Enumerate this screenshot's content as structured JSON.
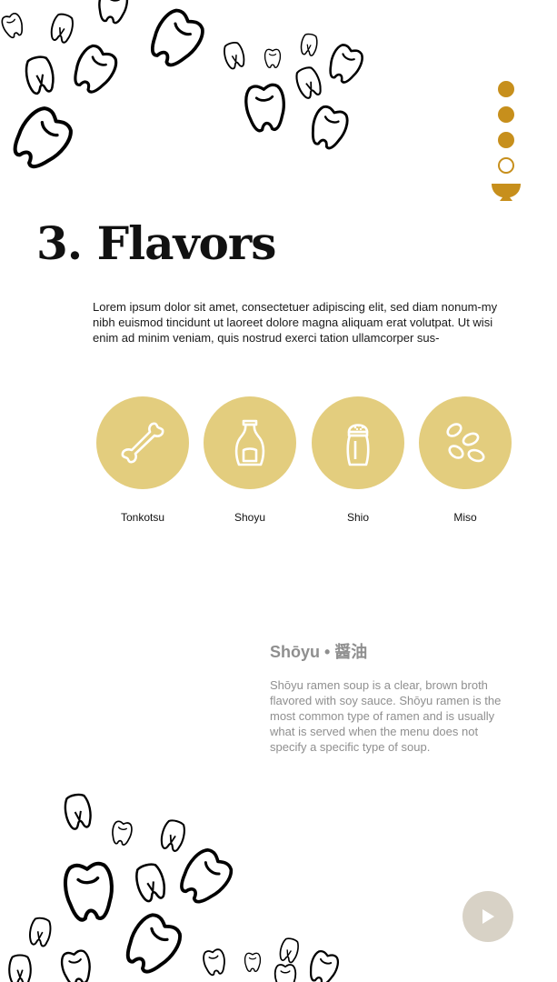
{
  "section": {
    "title": "3. Flavors",
    "lead": "Lorem ipsum dolor sit amet, consectetuer adipiscing elit, sed diam nonum-my nibh euismod tincidunt ut laoreet dolore magna aliquam erat volutpat. Ut wisi enim ad minim veniam, quis nostrud exerci tation ullamcorper sus-"
  },
  "progress": {
    "steps": [
      {
        "state": "complete"
      },
      {
        "state": "complete"
      },
      {
        "state": "complete"
      },
      {
        "state": "incomplete"
      }
    ],
    "icon": "ramen-bowl-icon",
    "accent_color": "#C78F1C"
  },
  "flavors": [
    {
      "label": "Tonkotsu",
      "icon": "bone-icon"
    },
    {
      "label": "Shoyu",
      "icon": "soy-sauce-bottle-icon"
    },
    {
      "label": "Shio",
      "icon": "salt-shaker-icon"
    },
    {
      "label": "Miso",
      "icon": "soybeans-icon"
    }
  ],
  "detail": {
    "title": "Shōyu • 醤油",
    "body": "Shōyu ramen soup is a clear, brown broth flavored with soy sauce. Shōyu ramen is the most common type of ramen and is usually what is served when the menu does not specify a specific type of soup."
  },
  "play_button": {
    "icon": "play-icon",
    "color": "#D8D2C6"
  },
  "colors": {
    "circle": "#E3CD7E",
    "accent": "#C78F1C",
    "muted_text": "#8f8f8f"
  }
}
